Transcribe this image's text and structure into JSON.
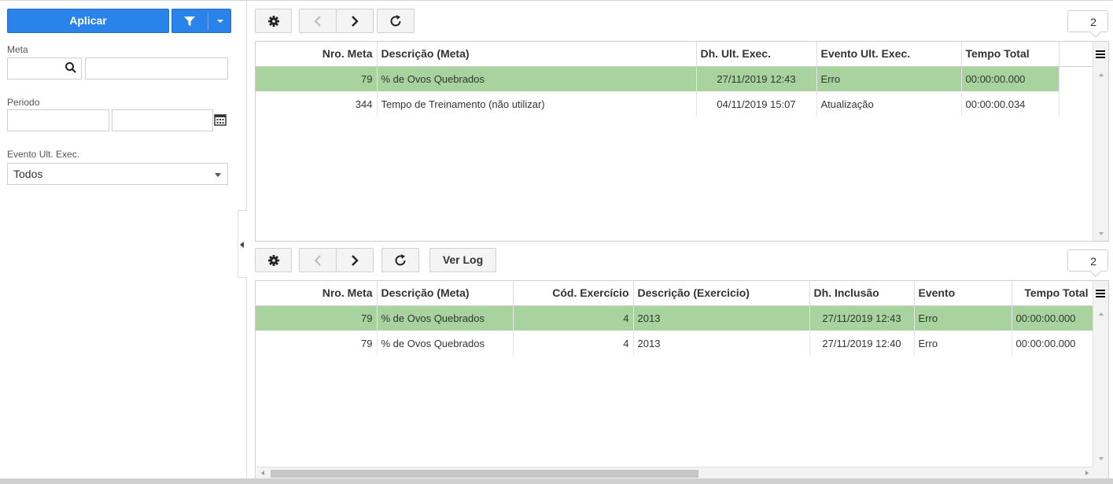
{
  "filters": {
    "apply_label": "Aplicar",
    "meta_label": "Meta",
    "meta_code_value": "",
    "meta_desc_value": "",
    "periodo_label": "Periodo",
    "periodo_start": "",
    "periodo_end": "",
    "evento_label": "Evento Ult. Exec.",
    "evento_selected": "Todos"
  },
  "top_grid": {
    "count": "2",
    "columns": [
      "Nro. Meta",
      "Descrição (Meta)",
      "Dh. Ult. Exec.",
      "Evento Ult. Exec.",
      "Tempo Total"
    ],
    "rows": [
      [
        "79",
        "% de Ovos Quebrados",
        "27/11/2019 12:43",
        "Erro",
        "00:00:00.000"
      ],
      [
        "344",
        "Tempo de Treinamento (não utilizar)",
        "04/11/2019 15:07",
        "Atualização",
        "00:00:00.034"
      ]
    ],
    "selected_row": 0
  },
  "bottom_grid": {
    "count": "2",
    "ver_log_label": "Ver Log",
    "columns": [
      "Nro. Meta",
      "Descrição (Meta)",
      "Cód. Exercício",
      "Descrição (Exercicio)",
      "Dh. Inclusão",
      "Evento",
      "Tempo Total"
    ],
    "rows": [
      [
        "79",
        "% de Ovos Quebrados",
        "4",
        "2013",
        "27/11/2019 12:43",
        "Erro",
        "00:00:00.000"
      ],
      [
        "79",
        "% de Ovos Quebrados",
        "4",
        "2013",
        "27/11/2019 12:40",
        "Erro",
        "00:00:00.000"
      ]
    ],
    "selected_row": 0
  },
  "colors": {
    "primary": "#2a83e9",
    "selected_row": "#a8d29e"
  },
  "icons": {
    "toolbar": [
      "gear-icon",
      "chevron-left-icon",
      "chevron-right-icon",
      "refresh-icon"
    ],
    "filter": [
      "search-icon",
      "calendar-icon",
      "funnel-icon",
      "caret-down-icon"
    ]
  }
}
